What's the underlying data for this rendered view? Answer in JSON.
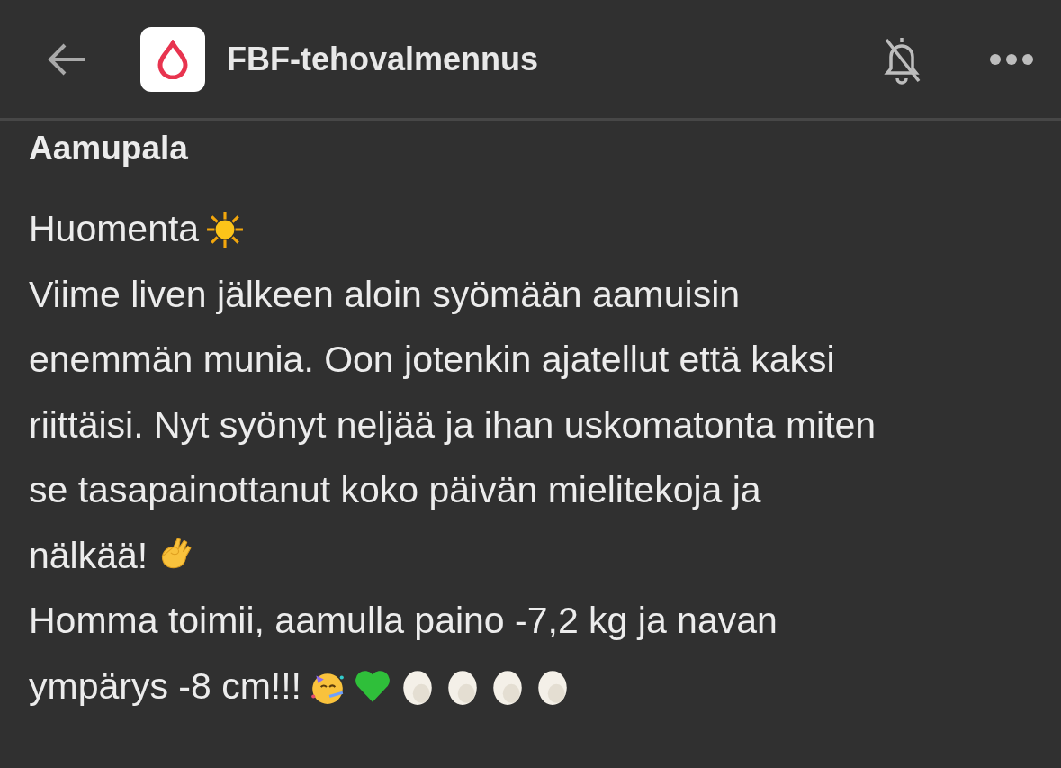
{
  "header": {
    "title": "FBF-tehovalmennus",
    "muted": true
  },
  "post": {
    "title": "Aamupala",
    "paragraphs": [
      {
        "lines": [
          "Huomenta"
        ],
        "emojis": [
          {
            "kind": "sun"
          }
        ]
      },
      {
        "lines": [
          "Viime liven jälkeen aloin syömään aamuisin",
          "enemmän munia. Oon jotenkin ajatellut että kaksi",
          "riittäisi. Nyt syönyt neljää ja ihan uskomatonta miten",
          "se tasapainottanut koko päivän mielitekoja ja",
          "nälkää!"
        ],
        "emojis": [
          {
            "kind": "ok-hand"
          }
        ]
      },
      {
        "lines": [
          "Homma toimii, aamulla paino -7,2 kg ja navan",
          "ympärys -8 cm!!!"
        ],
        "emojis": [
          {
            "kind": "party-face"
          },
          {
            "kind": "green-heart"
          },
          {
            "kind": "egg"
          },
          {
            "kind": "egg"
          },
          {
            "kind": "egg"
          },
          {
            "kind": "egg"
          }
        ]
      }
    ]
  }
}
